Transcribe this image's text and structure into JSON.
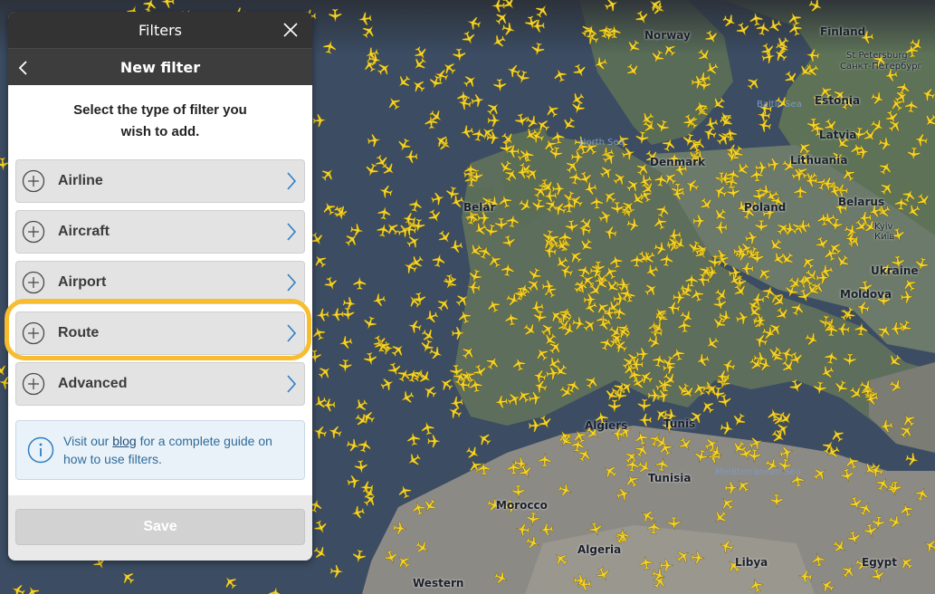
{
  "panel": {
    "title": "Filters",
    "subtitle": "New filter",
    "intro_line1": "Select the type of filter you",
    "intro_line2": "wish to add.",
    "filter_types": [
      {
        "label": "Airline"
      },
      {
        "label": "Aircraft"
      },
      {
        "label": "Airport"
      },
      {
        "label": "Route"
      },
      {
        "label": "Advanced"
      }
    ],
    "highlighted": "Route",
    "info": {
      "prefix": "Visit our ",
      "link": "blog",
      "suffix_line1": " for a complete guide on",
      "line2": "how to use filters."
    },
    "save_label": "Save"
  },
  "map": {
    "labels": {
      "norway": "Norway",
      "finland": "Finland",
      "st_petersburg": "St Petersburg",
      "st_petersburg_ru": "Санкт-Петербург",
      "estonia": "Estonia",
      "latvia": "Latvia",
      "lithuania": "Lithuania",
      "belarus": "Belarus",
      "kyiv": "Kyiv",
      "kyiv_ua": "Київ",
      "ukraine": "Ukraine",
      "moldova": "Moldova",
      "poland": "Poland",
      "denmark": "Denmark",
      "baltic_sea": "Baltic Sea",
      "north_sea": "North Sea",
      "belarus_short": "Belar",
      "algiers": "Algiers",
      "tunis": "Tunis",
      "tunisia": "Tunisia",
      "morocco": "Morocco",
      "algeria": "Algeria",
      "libya": "Libya",
      "egypt": "Egypt",
      "western": "Western",
      "mediterranean": "Mediterranean Sea"
    }
  },
  "colors": {
    "plane": "#f5d328",
    "highlight": "#f7bd2f",
    "header": "#333333",
    "info_text": "#2f6b9a"
  }
}
